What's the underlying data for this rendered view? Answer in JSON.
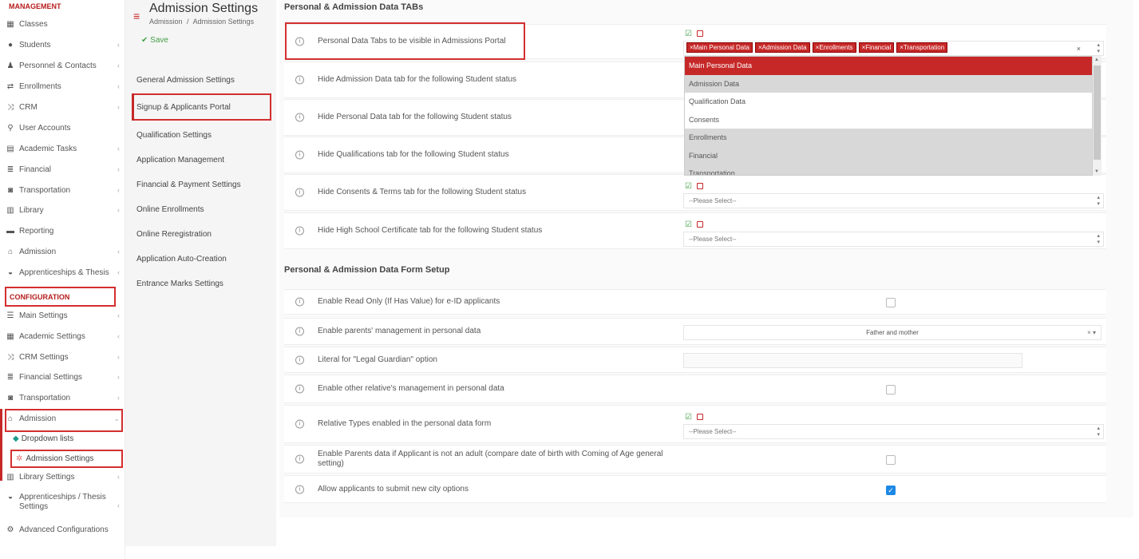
{
  "sidebar": {
    "management_label": "MANAGEMENT",
    "management_items": [
      {
        "label": "Classes",
        "icon": "classes-icon"
      },
      {
        "label": "Students",
        "icon": "students-icon"
      },
      {
        "label": "Personnel & Contacts",
        "icon": "personnel-icon"
      },
      {
        "label": "Enrollments",
        "icon": "enrollments-icon"
      },
      {
        "label": "CRM",
        "icon": "crm-icon"
      },
      {
        "label": "User Accounts",
        "icon": "key-icon"
      },
      {
        "label": "Academic Tasks",
        "icon": "tasks-icon"
      },
      {
        "label": "Financial",
        "icon": "coins-icon"
      },
      {
        "label": "Transportation",
        "icon": "bus-icon"
      },
      {
        "label": "Library",
        "icon": "books-icon"
      },
      {
        "label": "Reporting",
        "icon": "printer-icon"
      },
      {
        "label": "Admission",
        "icon": "institution-icon"
      },
      {
        "label": "Apprenticeships & Thesis",
        "icon": "graduation-icon"
      }
    ],
    "configuration_label": "CONFIGURATION",
    "configuration_items": [
      {
        "label": "Main Settings",
        "icon": "sliders-icon"
      },
      {
        "label": "Academic Settings",
        "icon": "classes-icon"
      },
      {
        "label": "CRM Settings",
        "icon": "crm-icon"
      },
      {
        "label": "Financial Settings",
        "icon": "coins-icon"
      },
      {
        "label": "Transportation",
        "icon": "bus-icon"
      },
      {
        "label": "Admission",
        "icon": "institution-icon"
      }
    ],
    "admission_sub": [
      {
        "label": "Dropdown lists"
      },
      {
        "label": "Admission Settings"
      }
    ],
    "tail_items": [
      {
        "label": "Library Settings"
      },
      {
        "label": "Apprenticeships / Thesis Settings"
      },
      {
        "label": "Advanced Configurations"
      }
    ]
  },
  "panel": {
    "title": "Admission Settings",
    "crumb_root": "Admission",
    "crumb_sep": "/",
    "crumb_current": "Admission Settings",
    "save_label": "Save",
    "menu": [
      "General Admission Settings",
      "Signup & Applicants Portal",
      "Qualification Settings",
      "Application Management",
      "Financial & Payment Settings",
      "Online Enrollments",
      "Online Reregistration",
      "Application Auto-Creation",
      "Entrance Marks Settings"
    ]
  },
  "main": {
    "section1_title": "Personal & Admission Data TABs",
    "section1_rows": [
      "Personal Data Tabs to be visible in Admissions Portal",
      "Hide Admission Data tab for the following Student status",
      "Hide Personal Data tab for the following Student status",
      "Hide Qualifications tab for the following Student status",
      "Hide Consents & Terms tab for the following Student status",
      "Hide High School Certificate tab for the following Student status"
    ],
    "selected_tags": [
      "Main Personal Data",
      "Admission Data",
      "Enrollments",
      "Financial",
      "Transportation"
    ],
    "please_select": "--Please Select--",
    "dropdown_options": [
      "Main Personal Data",
      "Admission Data",
      "Qualification Data",
      "Consents",
      "Enrollments",
      "Financial",
      "Transportation"
    ],
    "section2_title": "Personal & Admission Data Form Setup",
    "section2_rows": [
      "Enable Read Only (If Has Value) for e-ID applicants",
      "Enable parents' management in personal data",
      "Literal for \"Legal Guardian\" option",
      "Enable other relative's management in personal data",
      "Relative Types enabled in the personal data form",
      "Enable Parents data if Applicant is not an adult (compare date of birth with Coming of Age general setting)",
      "Allow applicants to submit new city options"
    ],
    "parents_value": "Father and mother",
    "allow_city_checked": true
  }
}
